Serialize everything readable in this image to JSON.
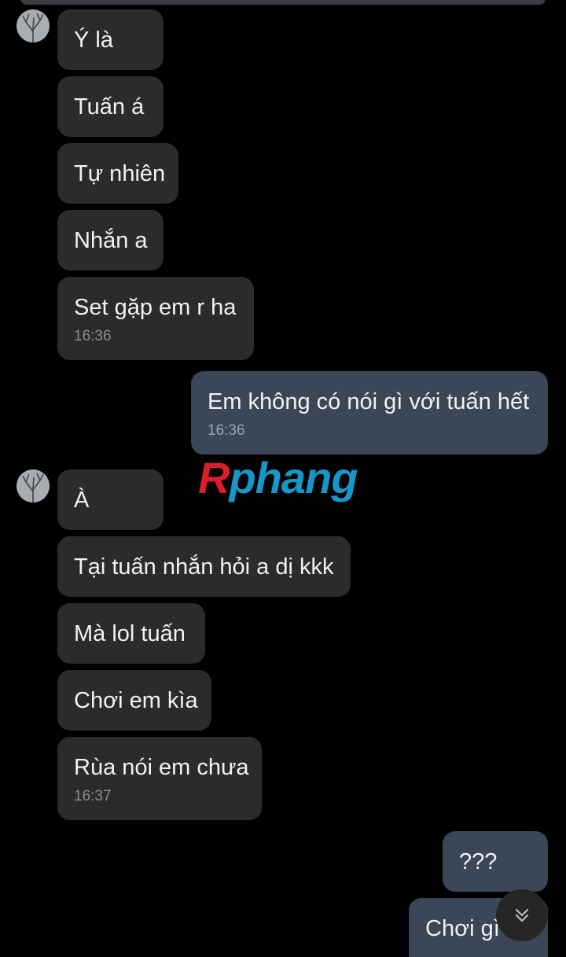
{
  "conversation": {
    "messages": [
      {
        "side": "in",
        "text": "Ý là",
        "time": ""
      },
      {
        "side": "in",
        "text": "Tuấn á",
        "time": ""
      },
      {
        "side": "in",
        "text": "Tự nhiên",
        "time": ""
      },
      {
        "side": "in",
        "text": "Nhắn a",
        "time": ""
      },
      {
        "side": "in",
        "text": "Set gặp em r ha",
        "time": "16:36"
      },
      {
        "side": "out",
        "text": "Em không có nói gì với tuấn hết",
        "time": "16:36"
      },
      {
        "side": "in",
        "text": "À",
        "time": ""
      },
      {
        "side": "in",
        "text": "Tại tuấn nhắn hỏi a dị kkk",
        "time": ""
      },
      {
        "side": "in",
        "text": "Mà lol tuấn",
        "time": ""
      },
      {
        "side": "in",
        "text": "Chơi em kìa",
        "time": ""
      },
      {
        "side": "in",
        "text": "Rùa nói em chưa",
        "time": "16:37"
      },
      {
        "side": "out",
        "text": "???",
        "time": ""
      },
      {
        "side": "out",
        "text": "Chơi gì",
        "time": ""
      }
    ]
  },
  "watermark": {
    "first_letter": "R",
    "rest": "phang"
  },
  "icons": {
    "avatar": "contact-avatar",
    "scroll_down": "double-chevron-down-icon"
  },
  "colors": {
    "background": "#000000",
    "incoming_bubble": "#2b2b2b",
    "outgoing_bubble": "#3b4756",
    "text": "#f2f2f2",
    "timestamp": "#8c8c8c"
  }
}
